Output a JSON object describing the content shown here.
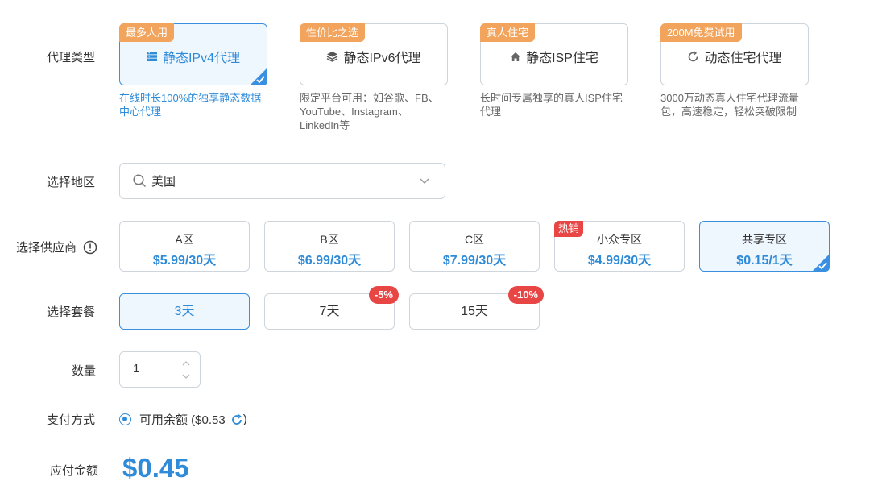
{
  "labels": {
    "proxy_type": "代理类型",
    "region": "选择地区",
    "provider": "选择供应商",
    "package": "选择套餐",
    "quantity": "数量",
    "payment": "支付方式",
    "amount_due": "应付金额"
  },
  "proxy_types": [
    {
      "badge": "最多人用",
      "title": "静态IPv4代理",
      "icon": "server-icon",
      "desc": "在线时长100%的独享静态数据中心代理",
      "selected": true
    },
    {
      "badge": "性价比之选",
      "title": "静态IPv6代理",
      "icon": "layers-icon",
      "desc": "限定平台可用：如谷歌、FB、YouTube、Instagram、LinkedIn等",
      "selected": false
    },
    {
      "badge": "真人住宅",
      "title": "静态ISP住宅",
      "icon": "home-icon",
      "desc": "长时间专属独享的真人ISP住宅代理",
      "selected": false
    },
    {
      "badge": "200M免费试用",
      "title": "动态住宅代理",
      "icon": "refresh-circle-icon",
      "desc": "3000万动态真人住宅代理流量包，高速稳定，轻松突破限制",
      "selected": false
    }
  ],
  "region": {
    "value": "美国",
    "icon": "search-icon"
  },
  "providers": [
    {
      "name": "A区",
      "price": "$5.99/30天",
      "hot": "",
      "selected": false
    },
    {
      "name": "B区",
      "price": "$6.99/30天",
      "hot": "",
      "selected": false
    },
    {
      "name": "C区",
      "price": "$7.99/30天",
      "hot": "",
      "selected": false
    },
    {
      "name": "小众专区",
      "price": "$4.99/30天",
      "hot": "热销",
      "selected": false
    },
    {
      "name": "共享专区",
      "price": "$0.15/1天",
      "hot": "",
      "selected": true
    }
  ],
  "packages": [
    {
      "label": "3天",
      "discount": "",
      "selected": true
    },
    {
      "label": "7天",
      "discount": "-5%",
      "selected": false
    },
    {
      "label": "15天",
      "discount": "-10%",
      "selected": false
    }
  ],
  "quantity": {
    "value": "1"
  },
  "payment": {
    "label": "可用余额 ($0.53",
    "close": ")"
  },
  "amount": "$0.45",
  "colors": {
    "accent": "#2f8bd8",
    "badge_orange": "#f3a45c",
    "hot_red": "#e84545",
    "selected_bg": "#eef6fe"
  }
}
